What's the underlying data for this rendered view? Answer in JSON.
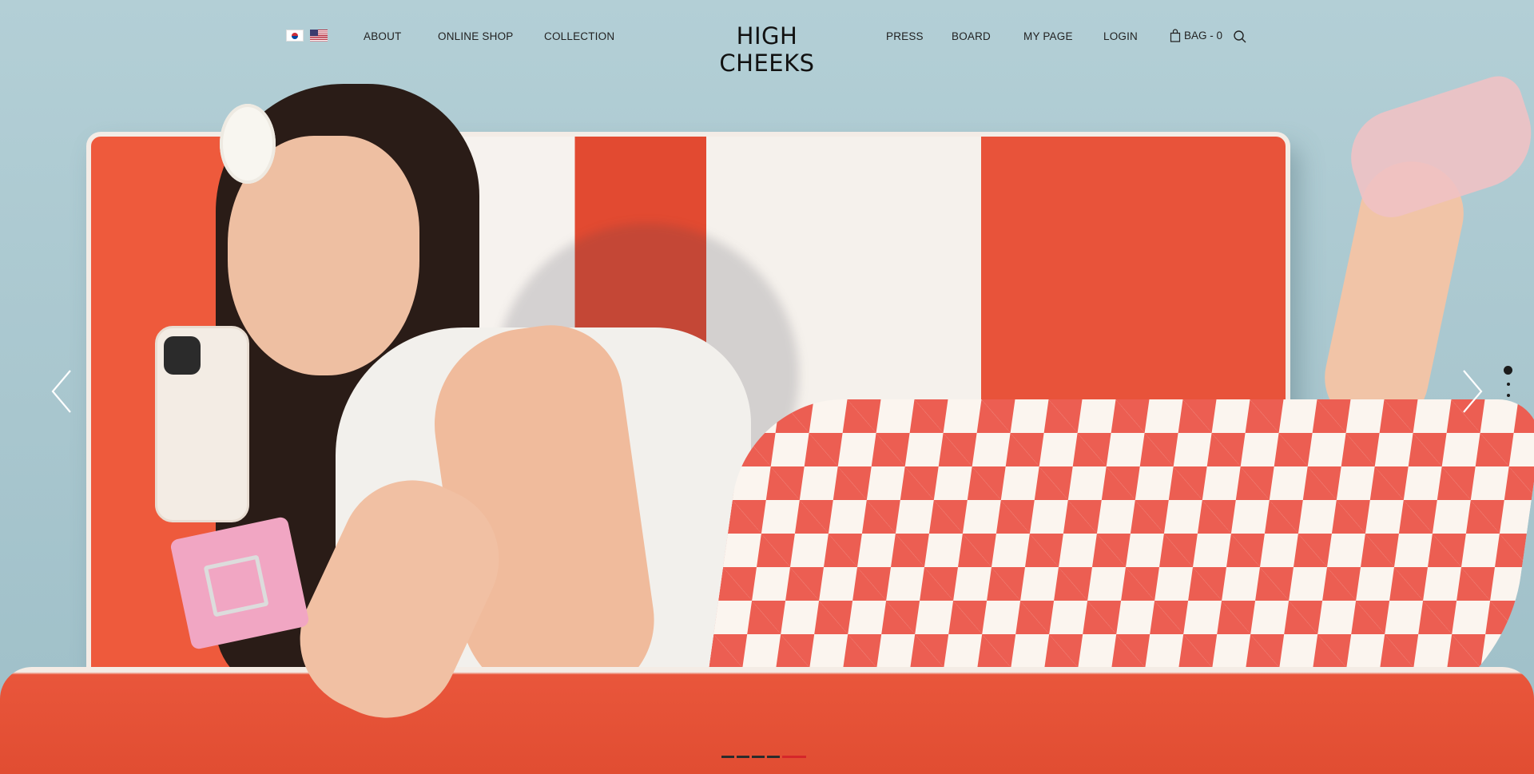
{
  "languages": [
    {
      "name": "korea-flag-icon",
      "label": "KR"
    },
    {
      "name": "usa-flag-icon",
      "label": "US"
    }
  ],
  "nav_left": [
    "ABOUT",
    "ONLINE SHOP",
    "COLLECTION"
  ],
  "brand": {
    "logo": "HIGH CHEEKS"
  },
  "nav_right": [
    "PRESS",
    "BOARD",
    "MY PAGE",
    "LOGIN"
  ],
  "bag": {
    "label": "BAG - 0",
    "icon": "shopping-bag-icon"
  },
  "search": {
    "icon": "search-icon"
  },
  "slider": {
    "prev_icon": "chevron-left-icon",
    "next_icon": "chevron-right-icon",
    "vertical_dots": 3,
    "active_dot": 1,
    "bottom_bars": 5,
    "active_bar": 5,
    "active_color": "#d6252a"
  },
  "hero": {
    "description_colors": {
      "sofa_red": "#e24a31",
      "sofa_white": "#f6f2ee",
      "wall": "#a9c7cf",
      "pants_check": "#ec5e52"
    }
  }
}
